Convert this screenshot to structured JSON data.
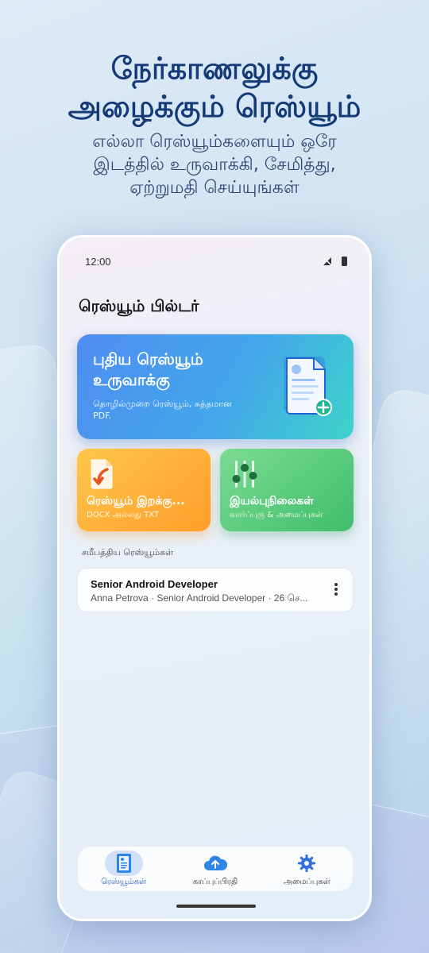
{
  "hero": {
    "title_line1": "நேர்காணலுக்கு",
    "title_line2": "அழைக்கும் ரெஸ்யூம்",
    "subtitle_line1": "எல்லா ரெஸ்யூம்களையும் ஒரே",
    "subtitle_line2": "இடத்தில் உருவாக்கி, சேமித்து,",
    "subtitle_line3": "ஏற்றுமதி செய்யுங்கள்"
  },
  "status_bar": {
    "time": "12:00"
  },
  "app": {
    "title": "ரெஸ்யூம் பில்டர்"
  },
  "create_card": {
    "title": "புதிய ரெஸ்யூம் உருவாக்கு",
    "subtitle": "தொழில்முறை ரெஸ்யூம், சுத்தமான PDF."
  },
  "import_card": {
    "title": "ரெஸ்யூம் இறக்கு...",
    "subtitle": "DOCX அல்லது TXT"
  },
  "templates_card": {
    "title": "இயல்புநிலைகள்",
    "subtitle": "வார்ப்புரு & அமைப்புகள்"
  },
  "recent": {
    "label": "சமீபத்திய ரெஸ்யூம்கள்",
    "items": [
      {
        "title": "Senior Android Developer",
        "subtitle": "Anna Petrova · Senior Android Developer · 26 செ..."
      }
    ]
  },
  "bottom_nav": {
    "items": [
      {
        "label": "ரெஸ்யூம்கள்",
        "icon": "resume-icon",
        "active": true
      },
      {
        "label": "காப்புப்பிரதி",
        "icon": "cloud-upload-icon",
        "active": false
      },
      {
        "label": "அமைப்புகள்",
        "icon": "gear-icon",
        "active": false
      }
    ]
  },
  "colors": {
    "accent": "#1a58c2",
    "create_gradient_start": "#4f8df2",
    "create_gradient_end": "#3dd3c9",
    "import_color": "#ff9d2a",
    "templates_color": "#3fbd6c"
  }
}
